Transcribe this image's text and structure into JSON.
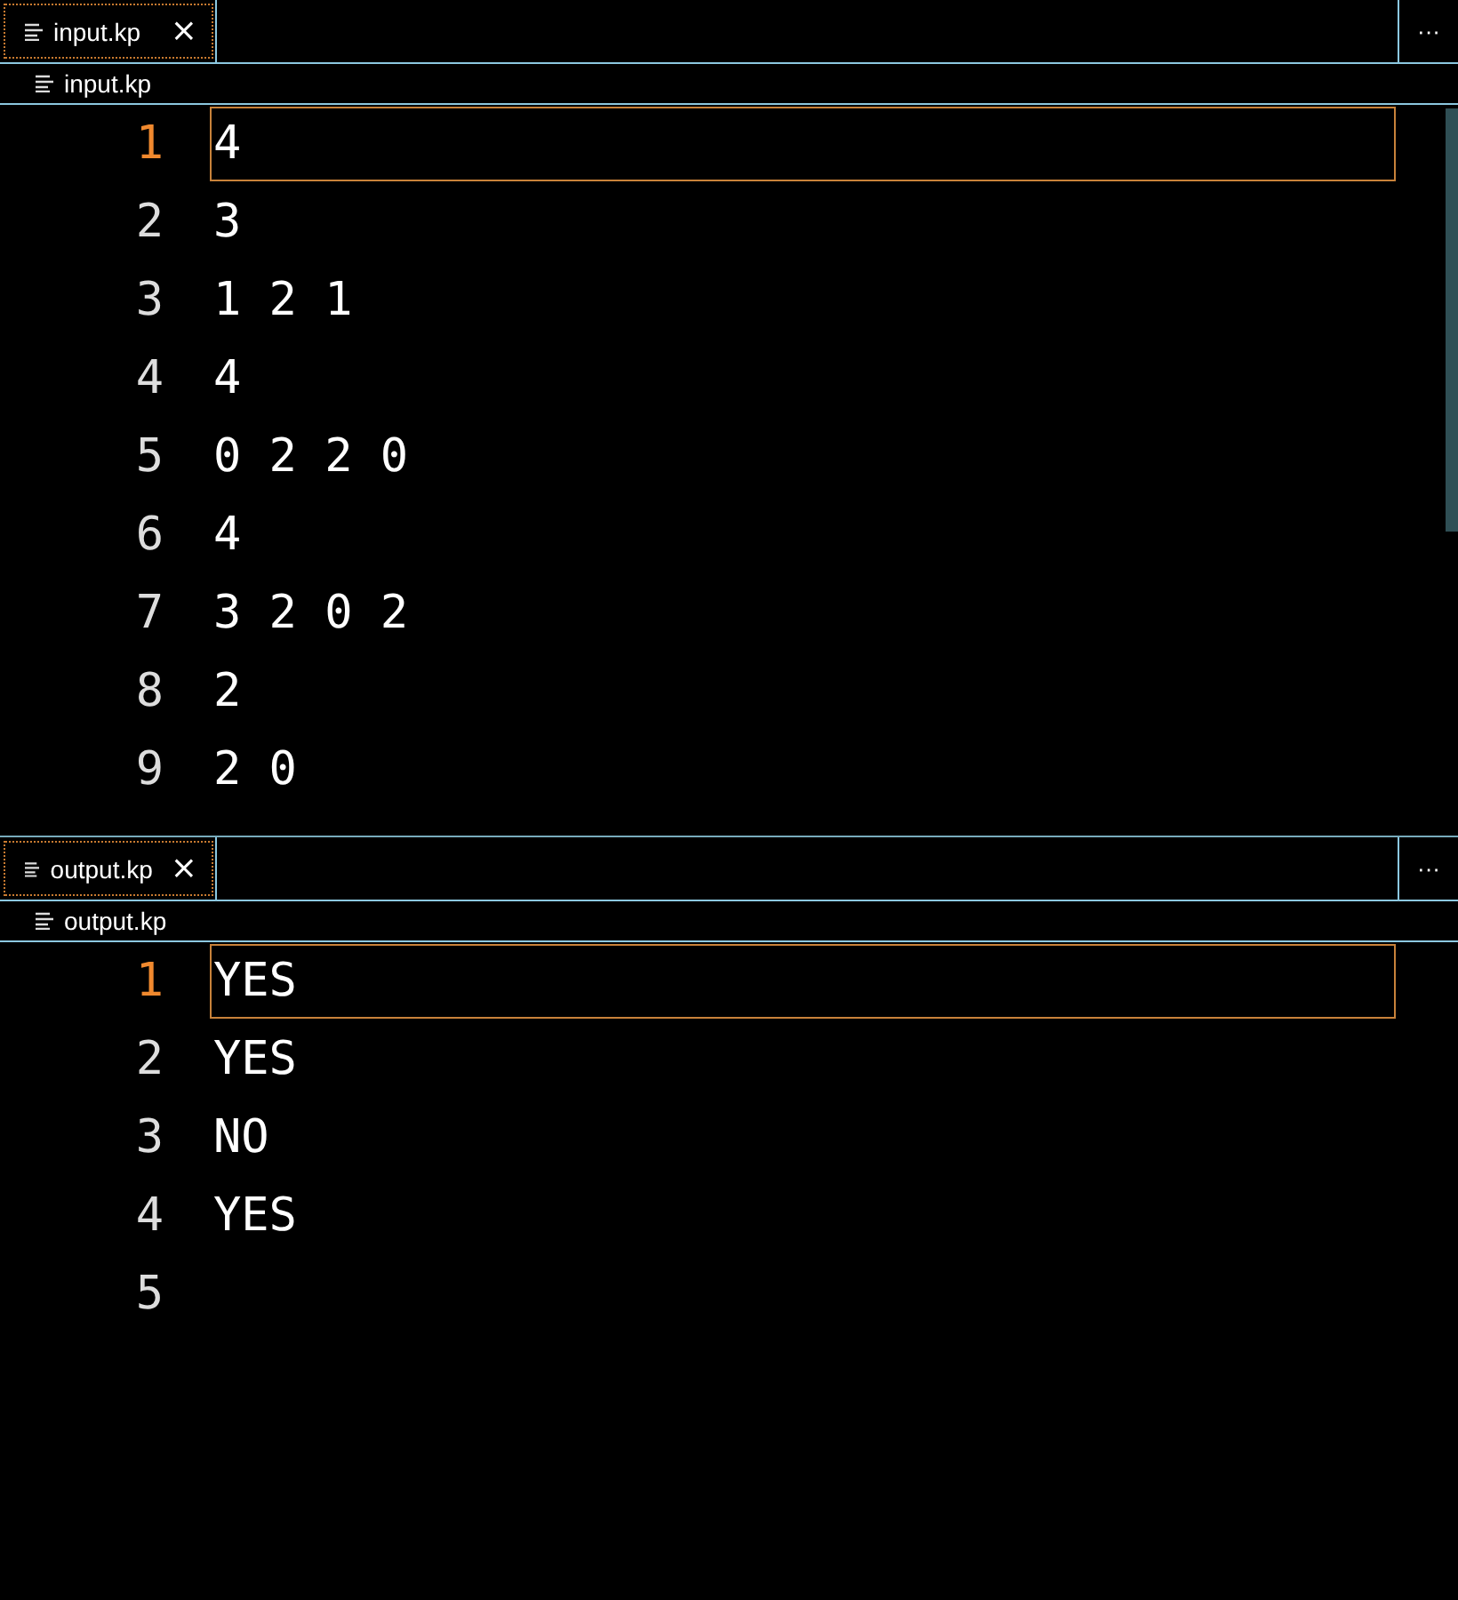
{
  "panes": [
    {
      "tab": {
        "label": "input.kp",
        "selected": true,
        "close": "×"
      },
      "more": "···",
      "breadcrumb": "input.kp",
      "scrollbar": true,
      "lines": [
        {
          "number": "1",
          "text": "4",
          "current": true
        },
        {
          "number": "2",
          "text": "3",
          "current": false
        },
        {
          "number": "3",
          "text": "1 2 1",
          "current": false
        },
        {
          "number": "4",
          "text": "4",
          "current": false
        },
        {
          "number": "5",
          "text": "0 2 2 0",
          "current": false
        },
        {
          "number": "6",
          "text": "4",
          "current": false
        },
        {
          "number": "7",
          "text": "3 2 0 2",
          "current": false
        },
        {
          "number": "8",
          "text": "2",
          "current": false
        },
        {
          "number": "9",
          "text": "2 0",
          "current": false
        }
      ]
    },
    {
      "tab": {
        "label": "output.kp",
        "selected": true,
        "close": "×"
      },
      "more": "···",
      "breadcrumb": "output.kp",
      "scrollbar": false,
      "lines": [
        {
          "number": "1",
          "text": "YES",
          "current": true
        },
        {
          "number": "2",
          "text": "YES",
          "current": false
        },
        {
          "number": "3",
          "text": "NO",
          "current": false
        },
        {
          "number": "4",
          "text": "YES",
          "current": false
        },
        {
          "number": "5",
          "current": false
        }
      ]
    }
  ]
}
